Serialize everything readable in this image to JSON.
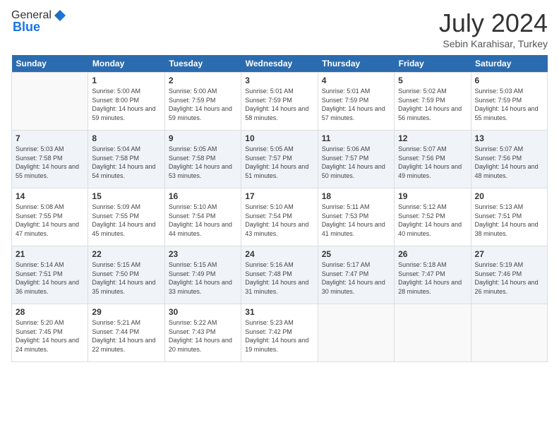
{
  "header": {
    "logo_general": "General",
    "logo_blue": "Blue",
    "month": "July 2024",
    "location": "Sebin Karahisar, Turkey"
  },
  "days_of_week": [
    "Sunday",
    "Monday",
    "Tuesday",
    "Wednesday",
    "Thursday",
    "Friday",
    "Saturday"
  ],
  "weeks": [
    [
      {
        "day": "",
        "empty": true
      },
      {
        "day": "1",
        "sunrise": "Sunrise: 5:00 AM",
        "sunset": "Sunset: 8:00 PM",
        "daylight": "Daylight: 14 hours and 59 minutes."
      },
      {
        "day": "2",
        "sunrise": "Sunrise: 5:00 AM",
        "sunset": "Sunset: 7:59 PM",
        "daylight": "Daylight: 14 hours and 59 minutes."
      },
      {
        "day": "3",
        "sunrise": "Sunrise: 5:01 AM",
        "sunset": "Sunset: 7:59 PM",
        "daylight": "Daylight: 14 hours and 58 minutes."
      },
      {
        "day": "4",
        "sunrise": "Sunrise: 5:01 AM",
        "sunset": "Sunset: 7:59 PM",
        "daylight": "Daylight: 14 hours and 57 minutes."
      },
      {
        "day": "5",
        "sunrise": "Sunrise: 5:02 AM",
        "sunset": "Sunset: 7:59 PM",
        "daylight": "Daylight: 14 hours and 56 minutes."
      },
      {
        "day": "6",
        "sunrise": "Sunrise: 5:03 AM",
        "sunset": "Sunset: 7:59 PM",
        "daylight": "Daylight: 14 hours and 55 minutes."
      }
    ],
    [
      {
        "day": "7",
        "sunrise": "Sunrise: 5:03 AM",
        "sunset": "Sunset: 7:58 PM",
        "daylight": "Daylight: 14 hours and 55 minutes."
      },
      {
        "day": "8",
        "sunrise": "Sunrise: 5:04 AM",
        "sunset": "Sunset: 7:58 PM",
        "daylight": "Daylight: 14 hours and 54 minutes."
      },
      {
        "day": "9",
        "sunrise": "Sunrise: 5:05 AM",
        "sunset": "Sunset: 7:58 PM",
        "daylight": "Daylight: 14 hours and 53 minutes."
      },
      {
        "day": "10",
        "sunrise": "Sunrise: 5:05 AM",
        "sunset": "Sunset: 7:57 PM",
        "daylight": "Daylight: 14 hours and 51 minutes."
      },
      {
        "day": "11",
        "sunrise": "Sunrise: 5:06 AM",
        "sunset": "Sunset: 7:57 PM",
        "daylight": "Daylight: 14 hours and 50 minutes."
      },
      {
        "day": "12",
        "sunrise": "Sunrise: 5:07 AM",
        "sunset": "Sunset: 7:56 PM",
        "daylight": "Daylight: 14 hours and 49 minutes."
      },
      {
        "day": "13",
        "sunrise": "Sunrise: 5:07 AM",
        "sunset": "Sunset: 7:56 PM",
        "daylight": "Daylight: 14 hours and 48 minutes."
      }
    ],
    [
      {
        "day": "14",
        "sunrise": "Sunrise: 5:08 AM",
        "sunset": "Sunset: 7:55 PM",
        "daylight": "Daylight: 14 hours and 47 minutes."
      },
      {
        "day": "15",
        "sunrise": "Sunrise: 5:09 AM",
        "sunset": "Sunset: 7:55 PM",
        "daylight": "Daylight: 14 hours and 45 minutes."
      },
      {
        "day": "16",
        "sunrise": "Sunrise: 5:10 AM",
        "sunset": "Sunset: 7:54 PM",
        "daylight": "Daylight: 14 hours and 44 minutes."
      },
      {
        "day": "17",
        "sunrise": "Sunrise: 5:10 AM",
        "sunset": "Sunset: 7:54 PM",
        "daylight": "Daylight: 14 hours and 43 minutes."
      },
      {
        "day": "18",
        "sunrise": "Sunrise: 5:11 AM",
        "sunset": "Sunset: 7:53 PM",
        "daylight": "Daylight: 14 hours and 41 minutes."
      },
      {
        "day": "19",
        "sunrise": "Sunrise: 5:12 AM",
        "sunset": "Sunset: 7:52 PM",
        "daylight": "Daylight: 14 hours and 40 minutes."
      },
      {
        "day": "20",
        "sunrise": "Sunrise: 5:13 AM",
        "sunset": "Sunset: 7:51 PM",
        "daylight": "Daylight: 14 hours and 38 minutes."
      }
    ],
    [
      {
        "day": "21",
        "sunrise": "Sunrise: 5:14 AM",
        "sunset": "Sunset: 7:51 PM",
        "daylight": "Daylight: 14 hours and 36 minutes."
      },
      {
        "day": "22",
        "sunrise": "Sunrise: 5:15 AM",
        "sunset": "Sunset: 7:50 PM",
        "daylight": "Daylight: 14 hours and 35 minutes."
      },
      {
        "day": "23",
        "sunrise": "Sunrise: 5:15 AM",
        "sunset": "Sunset: 7:49 PM",
        "daylight": "Daylight: 14 hours and 33 minutes."
      },
      {
        "day": "24",
        "sunrise": "Sunrise: 5:16 AM",
        "sunset": "Sunset: 7:48 PM",
        "daylight": "Daylight: 14 hours and 31 minutes."
      },
      {
        "day": "25",
        "sunrise": "Sunrise: 5:17 AM",
        "sunset": "Sunset: 7:47 PM",
        "daylight": "Daylight: 14 hours and 30 minutes."
      },
      {
        "day": "26",
        "sunrise": "Sunrise: 5:18 AM",
        "sunset": "Sunset: 7:47 PM",
        "daylight": "Daylight: 14 hours and 28 minutes."
      },
      {
        "day": "27",
        "sunrise": "Sunrise: 5:19 AM",
        "sunset": "Sunset: 7:46 PM",
        "daylight": "Daylight: 14 hours and 26 minutes."
      }
    ],
    [
      {
        "day": "28",
        "sunrise": "Sunrise: 5:20 AM",
        "sunset": "Sunset: 7:45 PM",
        "daylight": "Daylight: 14 hours and 24 minutes."
      },
      {
        "day": "29",
        "sunrise": "Sunrise: 5:21 AM",
        "sunset": "Sunset: 7:44 PM",
        "daylight": "Daylight: 14 hours and 22 minutes."
      },
      {
        "day": "30",
        "sunrise": "Sunrise: 5:22 AM",
        "sunset": "Sunset: 7:43 PM",
        "daylight": "Daylight: 14 hours and 20 minutes."
      },
      {
        "day": "31",
        "sunrise": "Sunrise: 5:23 AM",
        "sunset": "Sunset: 7:42 PM",
        "daylight": "Daylight: 14 hours and 19 minutes."
      },
      {
        "day": "",
        "empty": true
      },
      {
        "day": "",
        "empty": true
      },
      {
        "day": "",
        "empty": true
      }
    ]
  ]
}
